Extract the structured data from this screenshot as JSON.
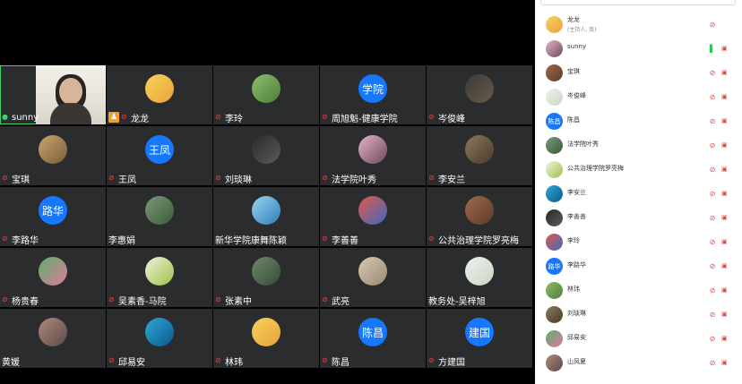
{
  "tiles": [
    [
      {
        "name": "sunny",
        "muted": false,
        "video": true
      },
      {
        "name": "龙龙",
        "host": true,
        "avatar": "img"
      },
      {
        "name": "李玲",
        "avatar": "img"
      },
      {
        "name": "周旭魁-健康学院",
        "avatar": "text",
        "avatar_text": "学院"
      },
      {
        "name": "岑俊峰",
        "avatar": "img"
      }
    ],
    [
      {
        "name": "宝琪",
        "avatar": "img"
      },
      {
        "name": "王凤",
        "avatar": "text",
        "avatar_text": "王凤"
      },
      {
        "name": "刘琰琳",
        "avatar": "img"
      },
      {
        "name": "法学院叶秀",
        "avatar": "img"
      },
      {
        "name": "李安兰",
        "avatar": "img"
      }
    ],
    [
      {
        "name": "李路华",
        "avatar": "text",
        "avatar_text": "路华"
      },
      {
        "name": "李惠娟",
        "avatar": "img",
        "nomic": true
      },
      {
        "name": "新华学院康舞陈颖",
        "avatar": "img",
        "nomic": true
      },
      {
        "name": "李善善",
        "avatar": "img"
      },
      {
        "name": "公共治理学院罗亮梅",
        "avatar": "img"
      }
    ],
    [
      {
        "name": "杨贵春",
        "avatar": "img"
      },
      {
        "name": "吴素香-马院",
        "avatar": "img"
      },
      {
        "name": "张素中",
        "avatar": "img"
      },
      {
        "name": "武亮",
        "avatar": "img"
      },
      {
        "name": "教务处-吴梓旭",
        "avatar": "img",
        "nomic": true
      }
    ],
    [
      {
        "name": "黄媛",
        "avatar": "img",
        "nomic": true
      },
      {
        "name": "邱易安",
        "avatar": "img"
      },
      {
        "name": "林玮",
        "avatar": "img"
      },
      {
        "name": "陈昌",
        "avatar": "text",
        "avatar_text": "陈昌"
      },
      {
        "name": "方建国",
        "avatar": "text",
        "avatar_text": "建国"
      }
    ]
  ],
  "participants": [
    {
      "name": "龙龙",
      "sub": "(主持人, 我)",
      "mic": "off",
      "avatar": "img"
    },
    {
      "name": "sunny",
      "mic": "on",
      "avatar": "img"
    },
    {
      "name": "宝琪",
      "mic": "off",
      "avatar": "img"
    },
    {
      "name": "岑俊峰",
      "mic": "off",
      "avatar": "img"
    },
    {
      "name": "陈昌",
      "mic": "off",
      "avatar": "text",
      "avatar_text": "陈昌"
    },
    {
      "name": "法学院叶秀",
      "mic": "off",
      "avatar": "img"
    },
    {
      "name": "公共治理学院罗亮梅",
      "mic": "off",
      "avatar": "img"
    },
    {
      "name": "李安兰",
      "mic": "off",
      "avatar": "img"
    },
    {
      "name": "李善善",
      "mic": "off",
      "avatar": "img"
    },
    {
      "name": "李玲",
      "mic": "off",
      "avatar": "img"
    },
    {
      "name": "李路华",
      "mic": "off",
      "avatar": "text",
      "avatar_text": "路华"
    },
    {
      "name": "林玮",
      "mic": "off",
      "avatar": "img"
    },
    {
      "name": "刘琰琳",
      "mic": "off",
      "avatar": "img"
    },
    {
      "name": "邱易安",
      "mic": "off",
      "avatar": "img"
    },
    {
      "name": "山风夏",
      "mic": "off",
      "avatar": "img"
    }
  ]
}
